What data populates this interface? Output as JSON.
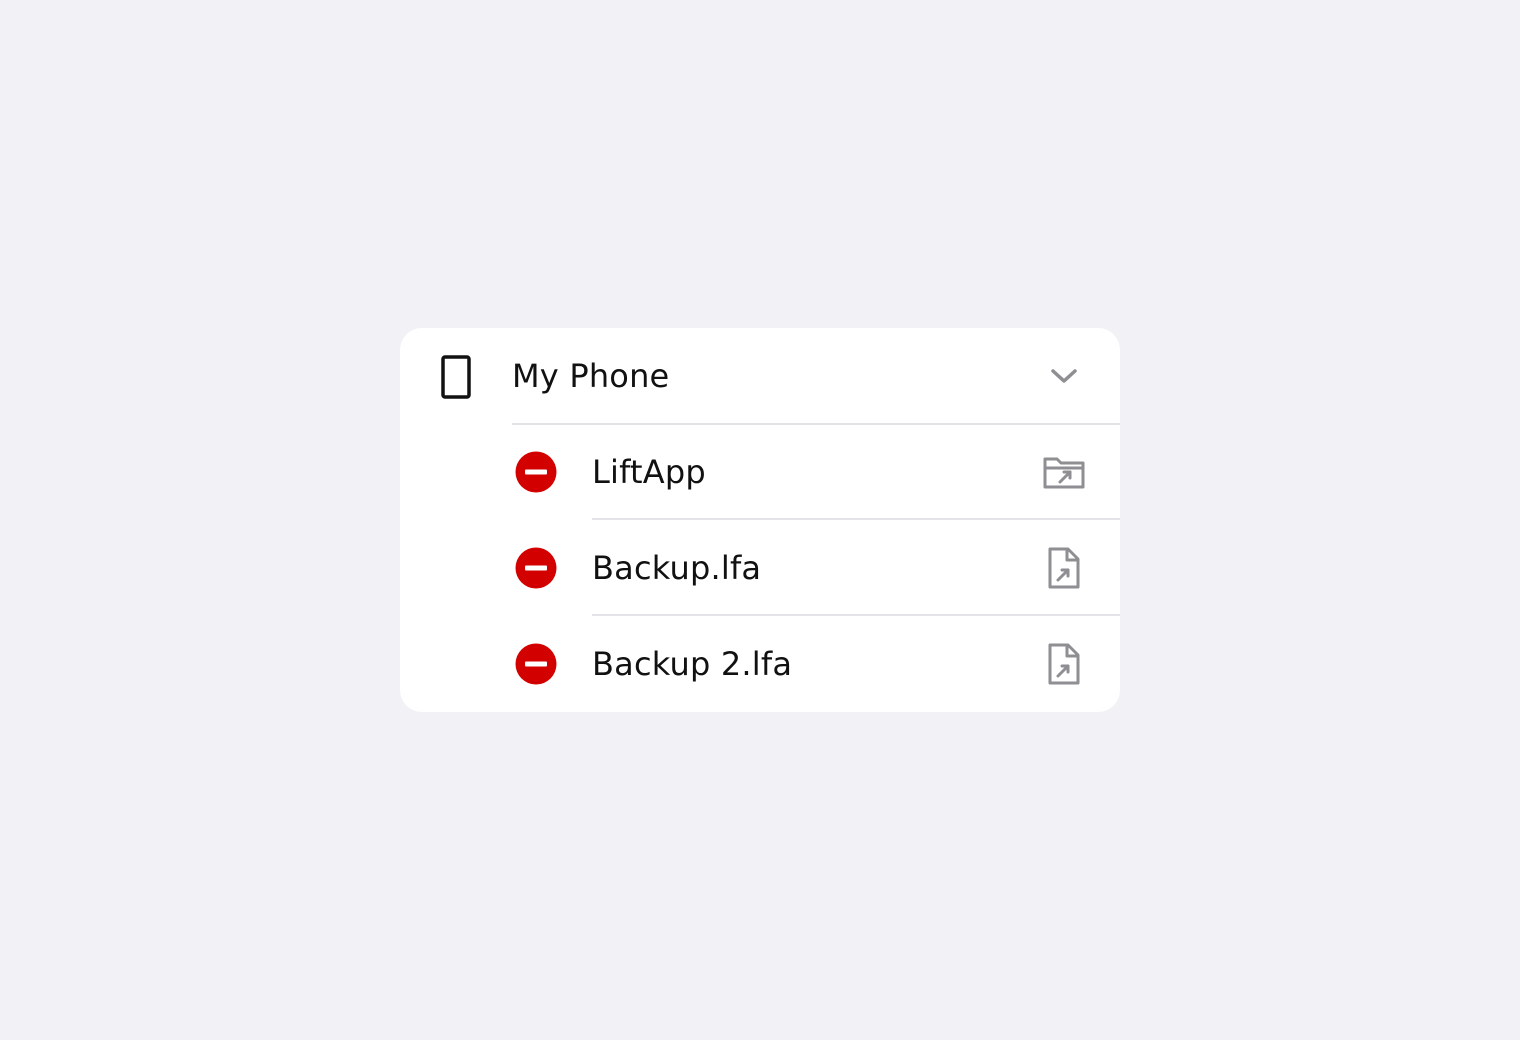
{
  "colors": {
    "background": "#f2f1f6",
    "card": "#ffffff",
    "destructive": "#d30000",
    "secondary_icon": "#8e8e93",
    "divider": "#e3e3e8",
    "text": "#111111"
  },
  "header": {
    "title": "My Phone",
    "icon": "phone-icon",
    "disclosure_icon": "chevron-down-icon"
  },
  "items": [
    {
      "label": "LiftApp",
      "remove_icon": "remove-icon",
      "action_icon": "folder-shortcut-icon"
    },
    {
      "label": "Backup.lfa",
      "remove_icon": "remove-icon",
      "action_icon": "file-shortcut-icon"
    },
    {
      "label": "Backup 2.lfa",
      "remove_icon": "remove-icon",
      "action_icon": "file-shortcut-icon"
    }
  ]
}
